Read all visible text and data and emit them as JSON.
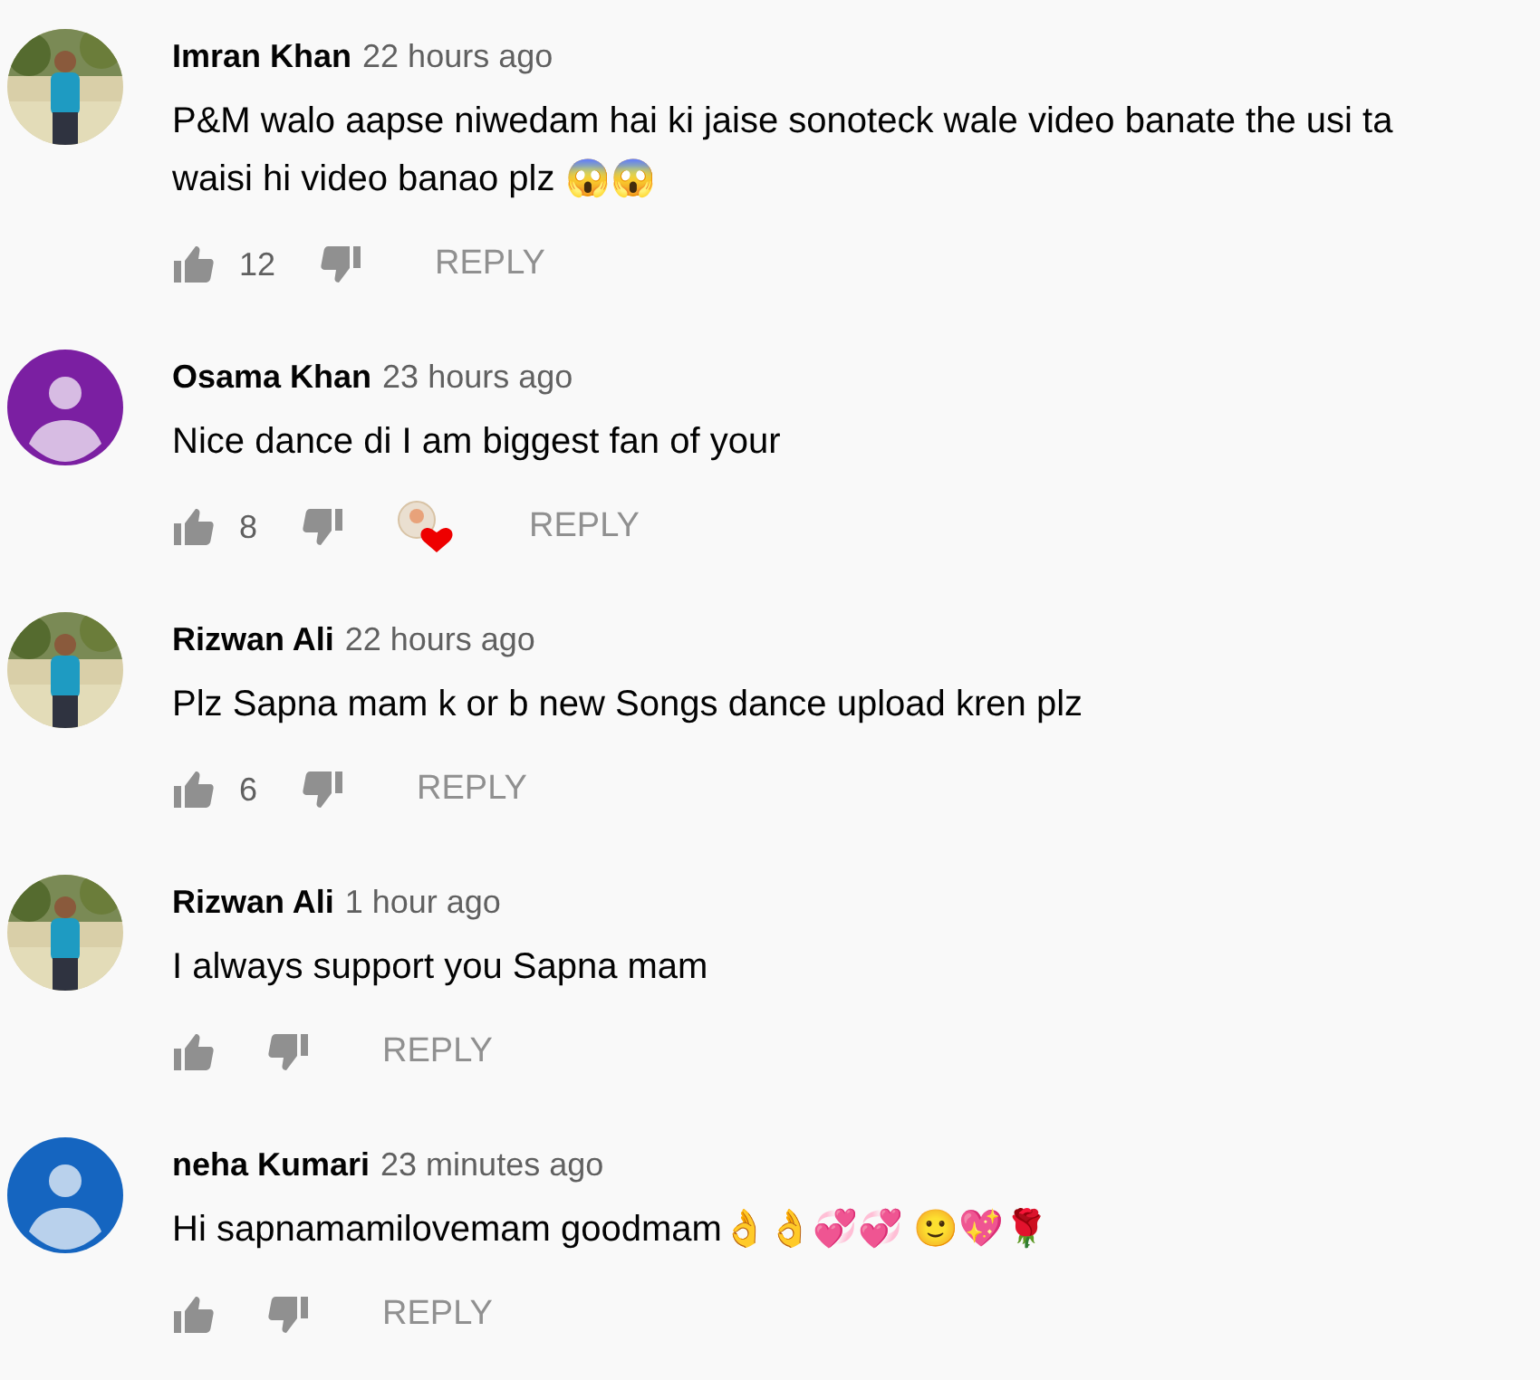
{
  "comments": [
    {
      "author": "Imran Khan",
      "time": "22 hours ago",
      "avatar": {
        "kind": "picture"
      },
      "lines": [
        "P&M walo aapse niwedam hai ki jaise sonoteck wale video banate the usi ta",
        "waisi hi video banao plz 😱😱"
      ],
      "likes": "12",
      "hearted": false,
      "reply": "REPLY"
    },
    {
      "author": "Osama Khan",
      "time": "23 hours ago",
      "avatar": {
        "kind": "default",
        "color": "#7b1fa2"
      },
      "lines": [
        "Nice dance di I am biggest fan of your"
      ],
      "likes": "8",
      "hearted": true,
      "reply": "REPLY"
    },
    {
      "author": "Rizwan Ali",
      "time": "22 hours ago",
      "avatar": {
        "kind": "picture"
      },
      "lines": [
        "Plz Sapna mam k or b new Songs dance upload kren plz"
      ],
      "likes": "6",
      "hearted": false,
      "reply": "REPLY"
    },
    {
      "author": "Rizwan Ali",
      "time": "1 hour ago",
      "avatar": {
        "kind": "picture"
      },
      "lines": [
        "I always support you Sapna mam"
      ],
      "hearted": false,
      "reply": "REPLY"
    },
    {
      "author": "neha Kumari",
      "time": "23 minutes ago",
      "avatar": {
        "kind": "default",
        "color": "#1565c0"
      },
      "lines": [
        "Hi sapnamamilovemam goodmam👌👌💞💞 🙂💖🌹"
      ],
      "hearted": false,
      "reply": "REPLY"
    }
  ]
}
